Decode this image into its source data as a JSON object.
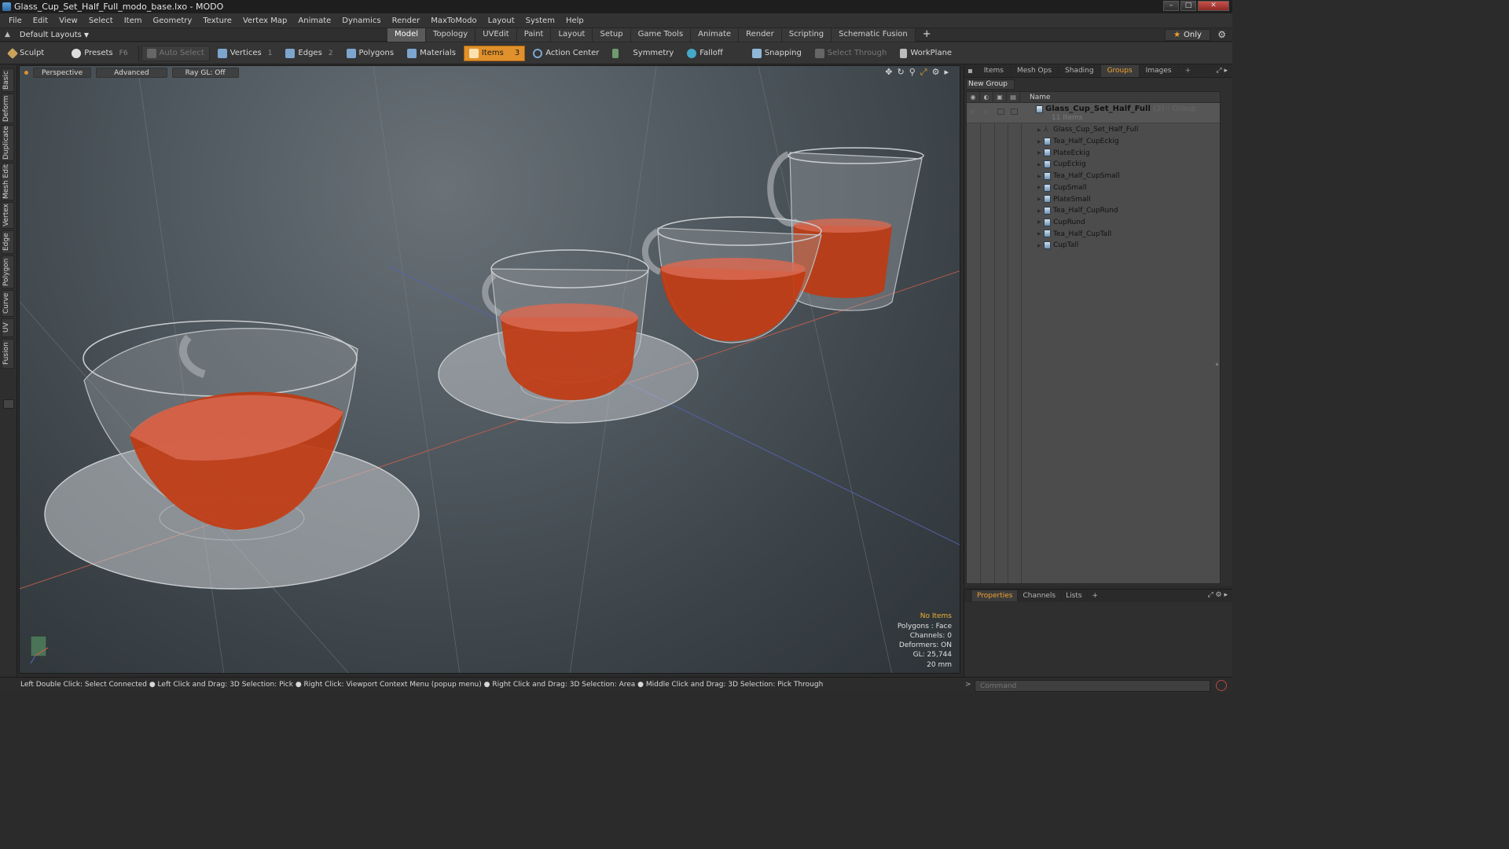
{
  "window": {
    "title": "Glass_Cup_Set_Half_Full_modo_base.lxo - MODO"
  },
  "menu": [
    "File",
    "Edit",
    "View",
    "Select",
    "Item",
    "Geometry",
    "Texture",
    "Vertex Map",
    "Animate",
    "Dynamics",
    "Render",
    "MaxToModo",
    "Layout",
    "System",
    "Help"
  ],
  "layout": {
    "dropdown": "Default Layouts",
    "tabs": [
      "Model",
      "Topology",
      "UVEdit",
      "Paint",
      "Layout",
      "Setup",
      "Game Tools",
      "Animate",
      "Render",
      "Scripting",
      "Schematic Fusion"
    ],
    "active_tab": "Model",
    "plus": "+",
    "only_label": "Only"
  },
  "toolbar": {
    "sculpt": "Sculpt",
    "presets": "Presets",
    "presets_key": "F6",
    "auto_select": "Auto Select",
    "vertices": "Vertices",
    "vertices_key": "1",
    "edges": "Edges",
    "edges_key": "2",
    "polygons": "Polygons",
    "materials": "Materials",
    "items": "Items",
    "action_center": "Action Center",
    "symmetry": "Symmetry",
    "falloff": "Falloff",
    "snapping": "Snapping",
    "select_through": "Select Through",
    "workplane": "WorkPlane"
  },
  "left_tabs": [
    "Basic",
    "Deform",
    "Duplicate",
    "Mesh Edit",
    "Vertex",
    "Edge",
    "Polygon",
    "Curve",
    "UV",
    "Fusion"
  ],
  "viewport": {
    "view": "Perspective",
    "mode": "Advanced",
    "raygl": "Ray GL: Off",
    "info": {
      "no_items": "No Items",
      "polygons": "Polygons : Face",
      "channels": "Channels: 0",
      "deformers": "Deformers: ON",
      "gl": "GL: 25,744",
      "scale": "20 mm"
    }
  },
  "right_panel": {
    "tabs": [
      "Items",
      "Mesh Ops",
      "Shading",
      "Groups",
      "Images"
    ],
    "active_tab": "Groups",
    "new_group": "New Group",
    "column_name": "Name",
    "group": {
      "name": "Glass_Cup_Set_Half_Full",
      "count": "(2)",
      "type": ": Group",
      "sub": "11 Items"
    },
    "items": [
      "Glass_Cup_Set_Half_Full",
      "Tea_Half_CupEckig",
      "PlateEckig",
      "CupEckig",
      "Tea_Half_CupSmall",
      "CupSmall",
      "PlateSmall",
      "Tea_Half_CupRund",
      "CupRund",
      "Tea_Half_CupTall",
      "CupTall"
    ]
  },
  "properties_panel": {
    "tabs": [
      "Properties",
      "Channels",
      "Lists"
    ],
    "active_tab": "Properties"
  },
  "status": {
    "hint": "Left Double Click: Select Connected ● Left Click and Drag: 3D Selection: Pick ● Right Click: Viewport Context Menu (popup menu) ● Right Click and Drag: 3D Selection: Area ● Middle Click and Drag: 3D Selection: Pick Through",
    "command_placeholder": "Command"
  },
  "colors": {
    "accent": "#e0912b",
    "tea": "#c83a12",
    "viewport_bg": "#4f575d"
  }
}
